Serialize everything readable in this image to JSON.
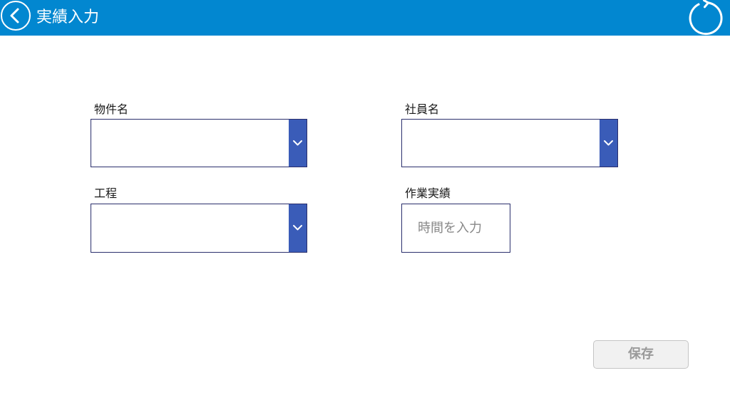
{
  "header": {
    "title": "実績入力",
    "background_color": "#0287d0",
    "back_icon": "chevron-left-circle-icon",
    "refresh_icon": "refresh-icon"
  },
  "form": {
    "property_name": {
      "label": "物件名",
      "value": ""
    },
    "employee_name": {
      "label": "社員名",
      "value": ""
    },
    "process": {
      "label": "工程",
      "value": ""
    },
    "work_record": {
      "label": "作業実績",
      "value": "",
      "placeholder": "時間を入力"
    }
  },
  "actions": {
    "save_label": "保存",
    "save_enabled": false
  }
}
